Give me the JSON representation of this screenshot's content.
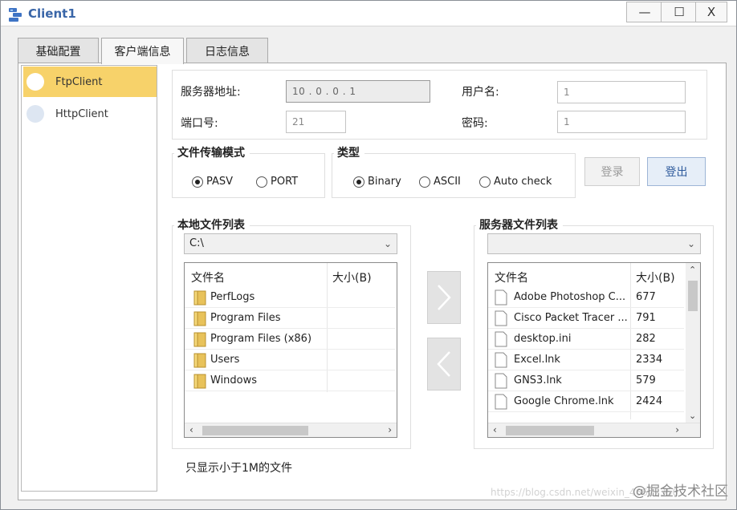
{
  "window": {
    "title": "Client1",
    "minimize": "—",
    "maximize": "☐",
    "close": "X"
  },
  "tabs": [
    {
      "label": "基础配置"
    },
    {
      "label": "客户端信息"
    },
    {
      "label": "日志信息"
    }
  ],
  "clients": [
    {
      "label": "FtpClient",
      "selected": true
    },
    {
      "label": "HttpClient",
      "selected": false
    }
  ],
  "connection": {
    "server_label": "服务器地址:",
    "server_ip": "10 . 0 . 0 . 1",
    "port_label": "端口号:",
    "port_value": "21",
    "user_label": "用户名:",
    "user_value": "1",
    "password_label": "密码:",
    "password_value": "1"
  },
  "transfer_mode": {
    "title": "文件传输模式",
    "options": [
      "PASV",
      "PORT"
    ],
    "selected": "PASV"
  },
  "type": {
    "title": "类型",
    "options": [
      "Binary",
      "ASCII",
      "Auto check"
    ],
    "selected": "Binary"
  },
  "buttons": {
    "login": "登录",
    "logout": "登出"
  },
  "local": {
    "title": "本地文件列表",
    "path": "C:\\",
    "col_name": "文件名",
    "col_size": "大小(B)",
    "rows": [
      {
        "name": "PerfLogs",
        "size": ""
      },
      {
        "name": "Program Files",
        "size": ""
      },
      {
        "name": "Program Files (x86)",
        "size": ""
      },
      {
        "name": "Users",
        "size": ""
      },
      {
        "name": "Windows",
        "size": ""
      }
    ]
  },
  "server": {
    "title": "服务器文件列表",
    "path": "",
    "col_name": "文件名",
    "col_size": "大小(B)",
    "rows": [
      {
        "name": "Adobe Photoshop C...",
        "size": "677"
      },
      {
        "name": "Cisco Packet Tracer ...",
        "size": "791"
      },
      {
        "name": "desktop.ini",
        "size": "282"
      },
      {
        "name": "Excel.lnk",
        "size": "2334"
      },
      {
        "name": "GNS3.lnk",
        "size": "579"
      },
      {
        "name": "Google Chrome.lnk",
        "size": "2424"
      }
    ]
  },
  "transfer_buttons": {
    "upload": "›",
    "download": "‹"
  },
  "footer_note": "只显示小于1M的文件",
  "watermark": "@掘金技术社区",
  "faint_url": "https://blog.csdn.net/weixin_46622350",
  "colors": {
    "selected_client": "#f7d26a",
    "accent": "#3a66a8"
  }
}
